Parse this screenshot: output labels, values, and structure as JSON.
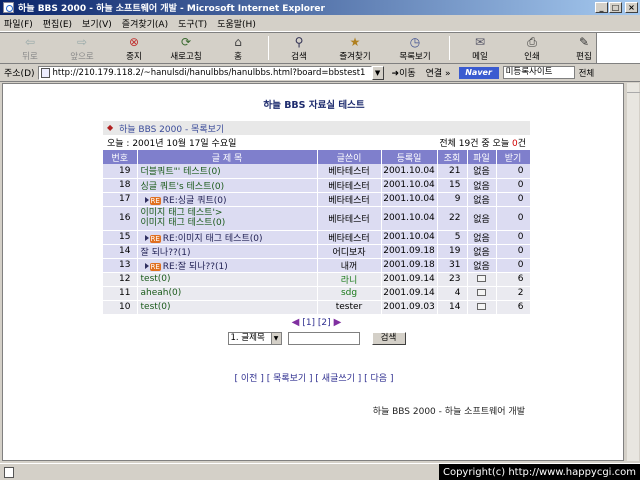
{
  "window": {
    "title": "하늘 BBS 2000 - 하늘 소프트웨어 개발 - Microsoft Internet Explorer",
    "minimize": "_",
    "maximize": "□",
    "close": "×"
  },
  "menu": [
    "파일(F)",
    "편집(E)",
    "보기(V)",
    "즐겨찾기(A)",
    "도구(T)",
    "도움말(H)"
  ],
  "toolbar": {
    "back": "뒤로",
    "forward": "앞으로",
    "stop": "중지",
    "refresh": "새로고침",
    "home": "홈",
    "search": "검색",
    "favorites": "즐겨찾기",
    "history": "목록보기",
    "mail": "메일",
    "print": "인쇄",
    "edit": "편집"
  },
  "address": {
    "label": "주소(D)",
    "url": "http://210.179.118.2/~hanulsdi/hanulbbs/hanulbbs.html?board=bbstest1",
    "go": "이동",
    "links": "연결 »",
    "naver": "Naver",
    "search_text": "미등록사이트",
    "total": "전체"
  },
  "board": {
    "page_title": "하늘 BBS 자료실 테스트",
    "header": "하늘 BBS 2000 - 목록보기",
    "date": "오늘 : 2001년 10월 17일 수요일",
    "stats_prefix": "전체 19건 중 오늘",
    "stats_today": "0",
    "stats_suffix": "건",
    "columns": [
      "번호",
      "글 제 목",
      "글쓴이",
      "등록일",
      "조회",
      "파일",
      "받기"
    ],
    "rows": [
      {
        "no": "19",
        "subject": "더블쿼트\"' 테스트(0)",
        "author": "베타테스터",
        "date": "2001.10.04",
        "views": "21",
        "file": "없음",
        "dl": "0"
      },
      {
        "no": "18",
        "subject": "싱글 쿼트's 테스트(0)",
        "author": "베타테스터",
        "date": "2001.10.04",
        "views": "15",
        "file": "없음",
        "dl": "0"
      },
      {
        "no": "17",
        "subject": "RE:싱글 쿼트(0)",
        "reply": true,
        "author": "베타테스터",
        "date": "2001.10.04",
        "views": "9",
        "file": "없음",
        "dl": "0"
      },
      {
        "no": "16",
        "subject": "이미지 태그 테스트'>",
        "subject2": "이미지 태그 테스트(0)",
        "author": "베타테스터",
        "date": "2001.10.04",
        "views": "22",
        "file": "없음",
        "dl": "0"
      },
      {
        "no": "15",
        "subject": "RE:이미지 태그 테스트(0)",
        "reply": true,
        "author": "베타테스터",
        "date": "2001.10.04",
        "views": "5",
        "file": "없음",
        "dl": "0"
      },
      {
        "no": "14",
        "subject": "잘 되나??(1)",
        "author": "어디보자",
        "date": "2001.09.18",
        "views": "19",
        "file": "없음",
        "dl": "0"
      },
      {
        "no": "13",
        "subject": "RE:잘 되나??(1)",
        "reply": true,
        "author": "내꺼",
        "date": "2001.09.18",
        "views": "31",
        "file": "없음",
        "dl": "0"
      },
      {
        "no": "12",
        "subject": "test(0)",
        "author": "라니",
        "date": "2001.09.14",
        "views": "23",
        "file": "icon",
        "dl": "6"
      },
      {
        "no": "11",
        "subject": "aheah(0)",
        "author": "sdg",
        "date": "2001.09.14",
        "views": "4",
        "file": "icon",
        "dl": "2"
      },
      {
        "no": "10",
        "subject": "test(0)",
        "author": "tester",
        "date": "2001.09.03",
        "views": "14",
        "file": "icon",
        "dl": "6"
      }
    ],
    "pager": "[1] [2]",
    "search_select": "1. 글제목",
    "search_button": "검색",
    "bottom_links": "[ 이전 ] [ 목록보기 ] [ 새글쓰기 ] [ 다음 ]",
    "footer": "하늘 BBS 2000 - 하늘 소프트웨어 개발"
  },
  "status": {
    "copyright": "Copyright(c) http://www.happycgi.com"
  }
}
